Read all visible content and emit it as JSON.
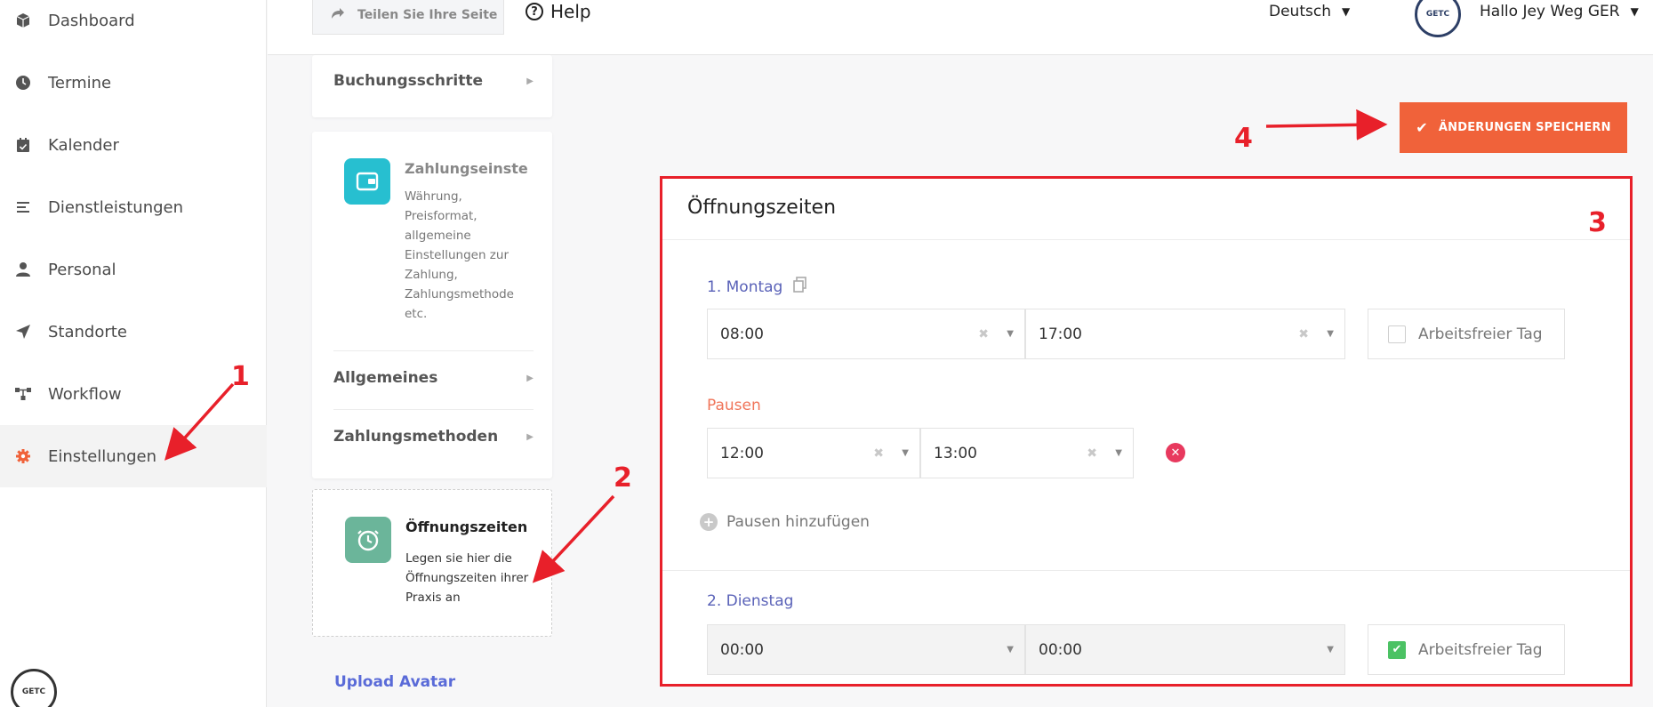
{
  "sidebar": {
    "items": [
      {
        "label": "Dashboard",
        "icon": "cube-icon"
      },
      {
        "label": "Termine",
        "icon": "clock-icon"
      },
      {
        "label": "Kalender",
        "icon": "calendar-check-icon"
      },
      {
        "label": "Dienstleistungen",
        "icon": "list-icon"
      },
      {
        "label": "Personal",
        "icon": "user-icon"
      },
      {
        "label": "Standorte",
        "icon": "location-arrow-icon"
      },
      {
        "label": "Workflow",
        "icon": "workflow-icon"
      },
      {
        "label": "Einstellungen",
        "icon": "gear-icon",
        "active": true
      }
    ]
  },
  "topbar": {
    "share_label": "Teilen Sie Ihre Seite",
    "help_label": "Help",
    "language": "Deutsch",
    "greeting": "Hallo Jey Weg GER"
  },
  "settings": {
    "booking_steps": "Buchungsschritte",
    "payment_card": {
      "title": "Zahlungseinste",
      "description": "Währung, Preisformat, allgemeine Einstellungen zur Zahlung, Zahlungsmethode etc."
    },
    "general": "Allgemeines",
    "payment_methods": "Zahlungsmethoden",
    "hours_card": {
      "title": "Öffnungszeiten",
      "description": "Legen sie hier die Öffnungszeiten ihrer Praxis an"
    },
    "upload_avatar": "Upload Avatar"
  },
  "main": {
    "save_label": "ÄNDERUNGEN SPEICHERN",
    "panel_title": "Öffnungszeiten",
    "days": [
      {
        "label": "1. Montag",
        "start": "08:00",
        "end": "17:00",
        "day_off_label": "Arbeitsfreier Tag",
        "day_off": false
      },
      {
        "label": "2. Dienstag",
        "start": "00:00",
        "end": "00:00",
        "day_off_label": "Arbeitsfreier Tag",
        "day_off": true
      }
    ],
    "breaks_label": "Pausen",
    "break": {
      "start": "12:00",
      "end": "13:00"
    },
    "add_break_label": "Pausen hinzufügen"
  },
  "annotations": {
    "n1": "1",
    "n2": "2",
    "n3": "3",
    "n4": "4"
  },
  "colors": {
    "accent": "#f0623a",
    "annotation": "#e8202a",
    "day_label": "#5a62b8",
    "breaks": "#f0755a",
    "teal_tile": "#27bfd0",
    "green_tile": "#6bb59a"
  }
}
